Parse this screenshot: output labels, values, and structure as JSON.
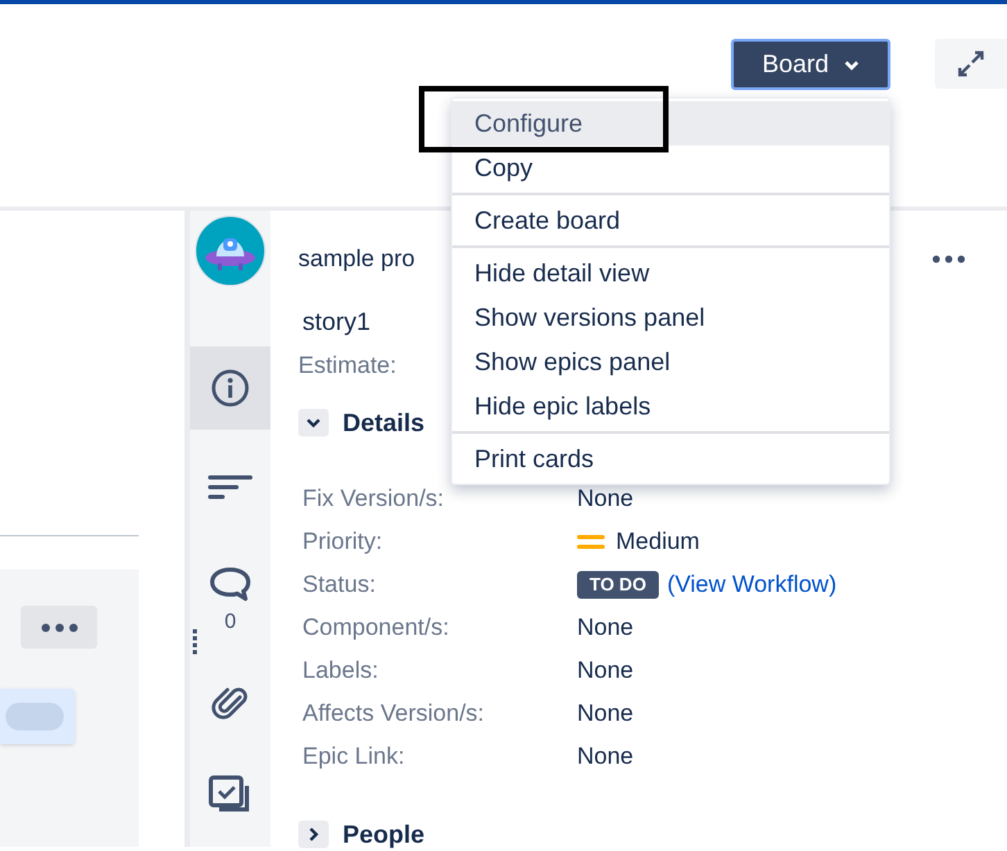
{
  "board_button": {
    "label": "Board"
  },
  "menu": {
    "sections": [
      {
        "items": [
          {
            "label": "Configure",
            "highlighted": true
          },
          {
            "label": "Copy",
            "highlighted": false
          }
        ]
      },
      {
        "items": [
          {
            "label": "Create board",
            "highlighted": false
          }
        ]
      },
      {
        "items": [
          {
            "label": "Hide detail view",
            "highlighted": false
          },
          {
            "label": "Show versions panel",
            "highlighted": false
          },
          {
            "label": "Show epics panel",
            "highlighted": false
          },
          {
            "label": "Hide epic labels",
            "highlighted": false
          }
        ]
      },
      {
        "items": [
          {
            "label": "Print cards",
            "highlighted": false
          }
        ]
      }
    ]
  },
  "sidebar": {
    "tabs": [
      {
        "kind": "info",
        "selected": true
      },
      {
        "kind": "sort",
        "selected": false
      },
      {
        "kind": "comments",
        "selected": false,
        "count": "0"
      },
      {
        "kind": "attachments",
        "selected": false
      },
      {
        "kind": "checklist",
        "selected": false
      }
    ]
  },
  "issue": {
    "project": "sample pro",
    "summary": "story1",
    "estimate_label": "Estimate:",
    "details": {
      "title": "Details",
      "expanded": true,
      "fields": [
        {
          "kind": "text",
          "label": "Fix Version/s:",
          "value": "None"
        },
        {
          "kind": "priority",
          "label": "Priority:",
          "value": "Medium"
        },
        {
          "kind": "status",
          "label": "Status:",
          "value": "TO DO",
          "link": "(View Workflow)"
        },
        {
          "kind": "text",
          "label": "Component/s:",
          "value": "None"
        },
        {
          "kind": "text",
          "label": "Labels:",
          "value": "None"
        },
        {
          "kind": "text",
          "label": "Affects Version/s:",
          "value": "None"
        },
        {
          "kind": "text",
          "label": "Epic Link:",
          "value": "None"
        }
      ]
    },
    "people": {
      "title": "People",
      "expanded": false
    }
  }
}
